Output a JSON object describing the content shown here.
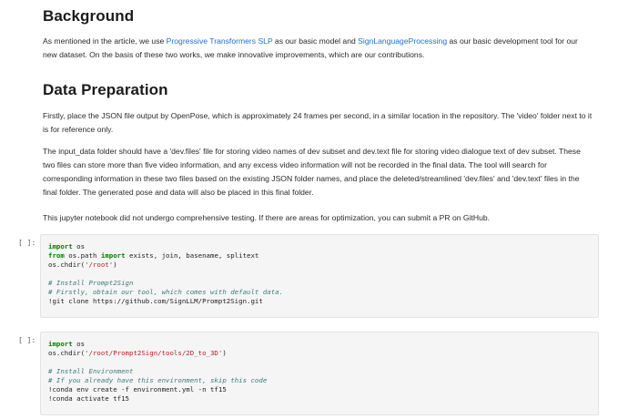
{
  "background_section": {
    "heading": "Background",
    "para_prefix": "As mentioned in the article, we use ",
    "link1": "Progressive Transformers SLP",
    "para_middle": " as our basic model and ",
    "link2": "SignLanguageProcessing",
    "para_suffix": " as our basic development tool for our new dataset. On the basis of these two works, we make innovative improvements, which are our contributions."
  },
  "data_prep_section": {
    "heading": "Data Preparation",
    "para1": "Firstly, place the JSON file output by OpenPose, which is approximately 24 frames per second, in a similar location in the repository. The 'video' folder next to it is for reference only.",
    "para2": "The input_data folder should have a 'dev.files' file for storing video names of dev subset and dev.text file for storing video dialogue text of dev subset. These two files can store more than five video information, and any excess video information will not be recorded in the final data. The tool will search for corresponding information in these two files based on the existing JSON folder names, and place the deleted/streamlined 'dev.files' and 'dev.text' files in the final folder. The generated pose and data will also be placed in this final folder.",
    "para3": "This jupyter notebook did not undergo comprehensive testing. If there are areas for optimization, you can submit a PR on GitHub."
  },
  "cells": [
    {
      "prompt": "[ ]:",
      "lines": [
        {
          "kw": "import",
          "rest": " os"
        },
        {
          "kw": "from",
          "mid": " os.path ",
          "kw2": "import",
          "rest": " exists, join, basename, splitext"
        },
        {
          "plain": "os.chdir(",
          "str": "'/root'",
          "tail": ")"
        },
        {
          "blank": ""
        },
        {
          "comment": "# Install Prompt2Sign"
        },
        {
          "comment": "# Firstly, obtain our tool, which comes with default data."
        },
        {
          "shell": "!git clone https://github.com/SignLLM/Prompt2Sign.git"
        }
      ]
    },
    {
      "prompt": "[ ]:",
      "lines": [
        {
          "kw": "import",
          "rest": " os"
        },
        {
          "plain": "os.chdir(",
          "str": "'/root/Prompt2Sign/tools/2D_to_3D'",
          "tail": ")"
        },
        {
          "blank": ""
        },
        {
          "comment": "# Install Environment"
        },
        {
          "comment": "# If you already have this environment, skip this code"
        },
        {
          "shell": "!conda env create -f environment.yml -n tf15"
        },
        {
          "shell": "!conda activate tf15"
        }
      ]
    }
  ]
}
